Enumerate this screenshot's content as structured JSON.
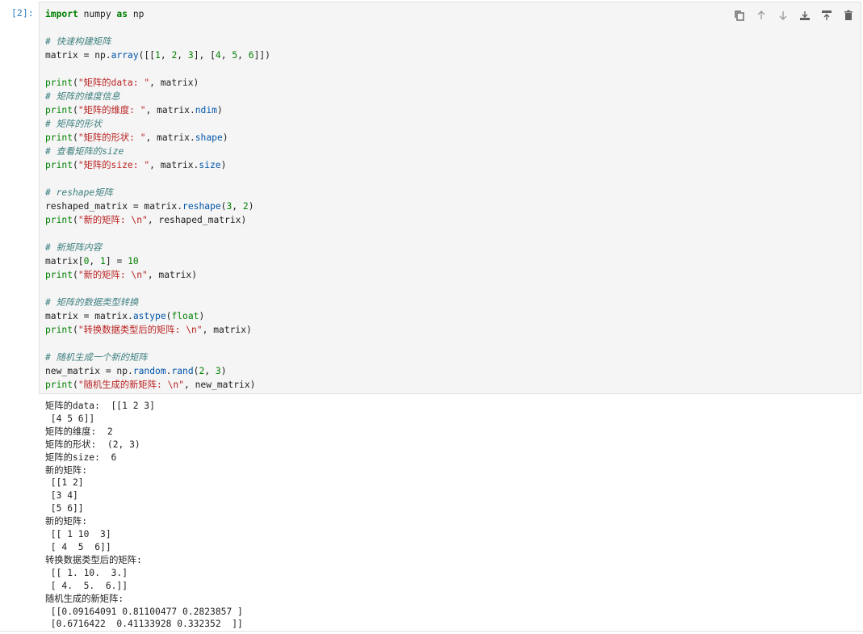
{
  "cell": {
    "prompt": "[2]:",
    "code_lines": [
      [
        [
          "import",
          "kw"
        ],
        [
          " numpy ",
          ""
        ],
        [
          "as",
          "kw"
        ],
        [
          " np",
          ""
        ]
      ],
      [],
      [
        [
          "# 快速构建矩阵",
          "cm"
        ]
      ],
      [
        [
          "matrix = np.",
          ""
        ],
        [
          "array",
          "at"
        ],
        [
          "([[",
          ""
        ],
        [
          "1",
          "nm"
        ],
        [
          ", ",
          ""
        ],
        [
          "2",
          "nm"
        ],
        [
          ", ",
          ""
        ],
        [
          "3",
          "nm"
        ],
        [
          "], [",
          ""
        ],
        [
          "4",
          "nm"
        ],
        [
          ", ",
          ""
        ],
        [
          "5",
          "nm"
        ],
        [
          ", ",
          ""
        ],
        [
          "6",
          "nm"
        ],
        [
          "]])",
          ""
        ]
      ],
      [],
      [
        [
          "print",
          "fn"
        ],
        [
          "(",
          ""
        ],
        [
          "\"矩阵的data: \"",
          "st"
        ],
        [
          ", matrix)",
          ""
        ]
      ],
      [
        [
          "# 矩阵的维度信息",
          "cm"
        ]
      ],
      [
        [
          "print",
          "fn"
        ],
        [
          "(",
          ""
        ],
        [
          "\"矩阵的维度: \"",
          "st"
        ],
        [
          ", matrix.",
          ""
        ],
        [
          "ndim",
          "at"
        ],
        [
          ")",
          ""
        ]
      ],
      [
        [
          "# 矩阵的形状",
          "cm"
        ]
      ],
      [
        [
          "print",
          "fn"
        ],
        [
          "(",
          ""
        ],
        [
          "\"矩阵的形状: \"",
          "st"
        ],
        [
          ", matrix.",
          ""
        ],
        [
          "shape",
          "at"
        ],
        [
          ")",
          ""
        ]
      ],
      [
        [
          "# 查看矩阵的size",
          "cm"
        ]
      ],
      [
        [
          "print",
          "fn"
        ],
        [
          "(",
          ""
        ],
        [
          "\"矩阵的size: \"",
          "st"
        ],
        [
          ", matrix.",
          ""
        ],
        [
          "size",
          "at"
        ],
        [
          ")",
          ""
        ]
      ],
      [],
      [
        [
          "# reshape矩阵",
          "cm"
        ]
      ],
      [
        [
          "reshaped_matrix = matrix.",
          ""
        ],
        [
          "reshape",
          "at"
        ],
        [
          "(",
          ""
        ],
        [
          "3",
          "nm"
        ],
        [
          ", ",
          ""
        ],
        [
          "2",
          "nm"
        ],
        [
          ")",
          ""
        ]
      ],
      [
        [
          "print",
          "fn"
        ],
        [
          "(",
          ""
        ],
        [
          "\"新的矩阵: \\n\"",
          "st"
        ],
        [
          ", reshaped_matrix)",
          ""
        ]
      ],
      [],
      [
        [
          "# 新矩阵内容",
          "cm"
        ]
      ],
      [
        [
          "matrix[",
          ""
        ],
        [
          "0",
          "nm"
        ],
        [
          ", ",
          ""
        ],
        [
          "1",
          "nm"
        ],
        [
          "] = ",
          ""
        ],
        [
          "10",
          "nm"
        ]
      ],
      [
        [
          "print",
          "fn"
        ],
        [
          "(",
          ""
        ],
        [
          "\"新的矩阵: \\n\"",
          "st"
        ],
        [
          ", matrix)",
          ""
        ]
      ],
      [],
      [
        [
          "# 矩阵的数据类型转换",
          "cm"
        ]
      ],
      [
        [
          "matrix = matrix.",
          ""
        ],
        [
          "astype",
          "at"
        ],
        [
          "(",
          ""
        ],
        [
          "float",
          "fn"
        ],
        [
          ")",
          ""
        ]
      ],
      [
        [
          "print",
          "fn"
        ],
        [
          "(",
          ""
        ],
        [
          "\"转换数据类型后的矩阵: \\n\"",
          "st"
        ],
        [
          ", matrix)",
          ""
        ]
      ],
      [],
      [
        [
          "# 随机生成一个新的矩阵",
          "cm"
        ]
      ],
      [
        [
          "new_matrix = np.",
          ""
        ],
        [
          "random",
          "at"
        ],
        [
          ".",
          ""
        ],
        [
          "rand",
          "at"
        ],
        [
          "(",
          ""
        ],
        [
          "2",
          "nm"
        ],
        [
          ", ",
          ""
        ],
        [
          "3",
          "nm"
        ],
        [
          ")",
          ""
        ]
      ],
      [
        [
          "print",
          "fn"
        ],
        [
          "(",
          ""
        ],
        [
          "\"随机生成的新矩阵: \\n\"",
          "st"
        ],
        [
          ", new_matrix)",
          ""
        ]
      ]
    ],
    "toolbar": [
      {
        "name": "duplicate-icon",
        "glyph": "copy"
      },
      {
        "name": "move-up-icon",
        "glyph": "up"
      },
      {
        "name": "move-down-icon",
        "glyph": "down"
      },
      {
        "name": "insert-above-icon",
        "glyph": "insert-above"
      },
      {
        "name": "insert-below-icon",
        "glyph": "insert-below"
      },
      {
        "name": "delete-icon",
        "glyph": "trash"
      }
    ]
  },
  "output_lines": [
    "矩阵的data:  [[1 2 3]",
    " [4 5 6]]",
    "矩阵的维度:  2",
    "矩阵的形状:  (2, 3)",
    "矩阵的size:  6",
    "新的矩阵:",
    " [[1 2]",
    " [3 4]",
    " [5 6]]",
    "新的矩阵:",
    " [[ 1 10  3]",
    " [ 4  5  6]]",
    "转换数据类型后的矩阵:",
    " [[ 1. 10.  3.]",
    " [ 4.  5.  6.]]",
    "随机生成的新矩阵:",
    " [[0.09164091 0.81100477 0.2823857 ]",
    " [0.6716422  0.41133928 0.332352  ]]"
  ]
}
